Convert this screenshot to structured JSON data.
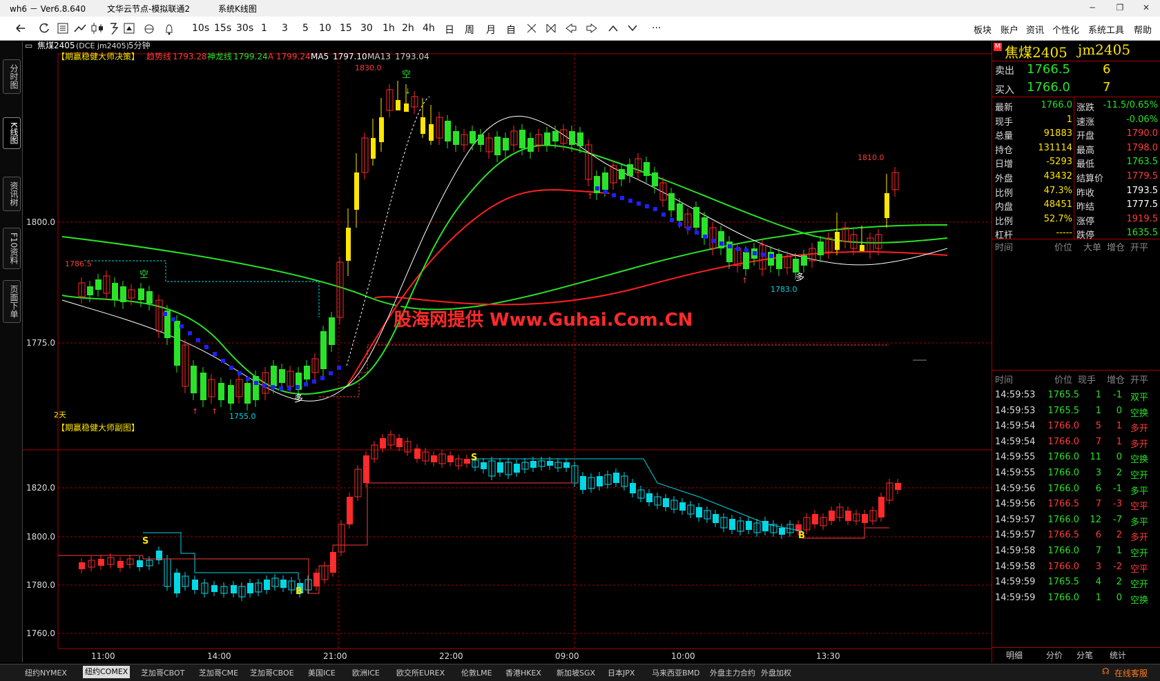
{
  "window": {
    "app_ver": "wh6 － Ver6.8.640",
    "server": "文华云节点-模拟联通2",
    "title": "系统K线图",
    "min": "─",
    "max": "❐",
    "close": "✕"
  },
  "toolbar": {
    "icons": [
      "back-icon",
      "refresh-icon",
      "list-icon",
      "trend-icon",
      "candle-icon",
      "f10-icon",
      "select-icon",
      "cloud-icon",
      "alarm-icon"
    ],
    "periods": [
      "10s",
      "15s",
      "30s",
      "1",
      "3",
      "5",
      "10",
      "15",
      "30",
      "1h",
      "2h",
      "4h",
      "日",
      "周",
      "月",
      "自"
    ],
    "right_menu": [
      "板块",
      "账户",
      "资讯",
      "个性化",
      "系统工具",
      "帮助"
    ],
    "more": "···"
  },
  "left_tabs": [
    "分时图",
    "K线图",
    "资讯树",
    "F10资料",
    "页面下单"
  ],
  "chart": {
    "symbol_line": "焦煤2405",
    "symbol_code": "(DCE jm2405)",
    "period": "5分钟",
    "main_indicator": "【期赢稳健大师决策】",
    "legend": [
      {
        "label": "趋势线",
        "value": "1793.28",
        "color": "#ff3b3b"
      },
      {
        "label": "神龙线",
        "value": "1799.24",
        "color": "#29e329"
      },
      {
        "label": "A",
        "value": "1799.24",
        "color": "#ff3b3b"
      },
      {
        "label": "MA5",
        "value": "1797.10",
        "color": "#ffffff"
      },
      {
        "label": "MA13",
        "value": "1793.04",
        "color": "#cccccc"
      }
    ],
    "watermark": "股海网提供 Www.Guhai.Com.CN",
    "main_y_labels": [
      "1800.0",
      "1775.0"
    ],
    "annotations": {
      "high": "1830.0",
      "low": "1755.0",
      "mid_low": "1783.0",
      "right_high": "1810.0",
      "left_label": "1786.5",
      "days": "2天",
      "kong1": "空",
      "kong2": "空",
      "duo1": "多",
      "duo2": "多"
    },
    "sub_indicator": "【期赢稳健大师副图】",
    "sub_y_labels": [
      "1820.0",
      "1800.0",
      "1780.0",
      "1760.0"
    ],
    "sub_marks": {
      "s1": "S",
      "s2": "S",
      "b1": "B",
      "b2": "B"
    },
    "x_labels": [
      "11:00",
      "14:00",
      "21:00",
      "22:00",
      "09:00",
      "10:00",
      "13:30"
    ]
  },
  "quote": {
    "m_badge": "M",
    "name": "焦煤2405",
    "code": "jm2405",
    "sell": {
      "label": "卖出",
      "price": "1766.5",
      "vol": "6"
    },
    "buy": {
      "label": "买入",
      "price": "1766.0",
      "vol": "7"
    },
    "rows": [
      {
        "l1": "最新",
        "v1": "1766.0",
        "c1": "g",
        "l2": "涨跌",
        "v2": "-11.5/0.65%",
        "c2": "g"
      },
      {
        "l1": "现手",
        "v1": "1",
        "c1": "y",
        "l2": "速涨",
        "v2": "-0.06%",
        "c2": "g"
      },
      {
        "l1": "总量",
        "v1": "91883",
        "c1": "y",
        "l2": "开盘",
        "v2": "1790.0",
        "c2": "r"
      },
      {
        "l1": "持仓",
        "v1": "131114",
        "c1": "y",
        "l2": "最高",
        "v2": "1798.0",
        "c2": "r"
      },
      {
        "l1": "日增",
        "v1": "-5293",
        "c1": "y",
        "l2": "最低",
        "v2": "1763.5",
        "c2": "g"
      },
      {
        "l1": "外盘",
        "v1": "43432",
        "c1": "y",
        "l2": "结算价",
        "v2": "1779.5",
        "c2": "r"
      },
      {
        "l1": "比例",
        "v1": "47.3%",
        "c1": "y",
        "l2": "昨收",
        "v2": "1793.5",
        "c2": "w"
      },
      {
        "l1": "内盘",
        "v1": "48451",
        "c1": "y",
        "l2": "昨结",
        "v2": "1777.5",
        "c2": "w"
      },
      {
        "l1": "比例",
        "v1": "52.7%",
        "c1": "y",
        "l2": "涨停",
        "v2": "1919.5",
        "c2": "r"
      },
      {
        "l1": "杠杆",
        "v1": "-----",
        "c1": "y",
        "l2": "跌停",
        "v2": "1635.5",
        "c2": "g"
      }
    ],
    "big_header": [
      "时间",
      "价位",
      "大单",
      "增仓",
      "开平"
    ],
    "tick_header": [
      "时间",
      "价位",
      "现手",
      "增仓",
      "开平"
    ],
    "ticks": [
      [
        "14:59:53",
        "1765.5",
        "1",
        "-1",
        "双平",
        "g"
      ],
      [
        "14:59:53",
        "1765.5",
        "1",
        "0",
        "空换",
        "g"
      ],
      [
        "14:59:54",
        "1766.0",
        "5",
        "1",
        "多开",
        "r"
      ],
      [
        "14:59:54",
        "1766.0",
        "7",
        "1",
        "多开",
        "r"
      ],
      [
        "14:59:55",
        "1766.0",
        "11",
        "0",
        "空换",
        "g"
      ],
      [
        "14:59:55",
        "1766.0",
        "3",
        "2",
        "空开",
        "g"
      ],
      [
        "14:59:56",
        "1766.0",
        "6",
        "-1",
        "多平",
        "g"
      ],
      [
        "14:59:56",
        "1766.5",
        "7",
        "-3",
        "空平",
        "r"
      ],
      [
        "14:59:57",
        "1766.0",
        "12",
        "-7",
        "多平",
        "g"
      ],
      [
        "14:59:57",
        "1766.5",
        "6",
        "2",
        "多开",
        "r"
      ],
      [
        "14:59:58",
        "1766.0",
        "7",
        "1",
        "空开",
        "g"
      ],
      [
        "14:59:58",
        "1766.0",
        "3",
        "-2",
        "空平",
        "r"
      ],
      [
        "14:59:59",
        "1765.5",
        "4",
        "2",
        "空开",
        "g"
      ],
      [
        "14:59:59",
        "1766.0",
        "1",
        "0",
        "空换",
        "g"
      ]
    ],
    "tabs": [
      "明细",
      "分价",
      "分笔",
      "统计"
    ]
  },
  "bottom_tabs": [
    "纽约NYMEX",
    "纽约COMEX",
    "芝加哥CBOT",
    "芝加哥CME",
    "芝加哥CBOE",
    "美国ICE",
    "欧洲ICE",
    "欧交所EUREX",
    "伦敦LME",
    "香港HKEX",
    "新加坡SGX",
    "日本JPX",
    "马来西亚BMD",
    "外盘主力合约",
    "外盘加权"
  ],
  "bottom_active": "纽约COMEX",
  "service": "在线客服"
}
